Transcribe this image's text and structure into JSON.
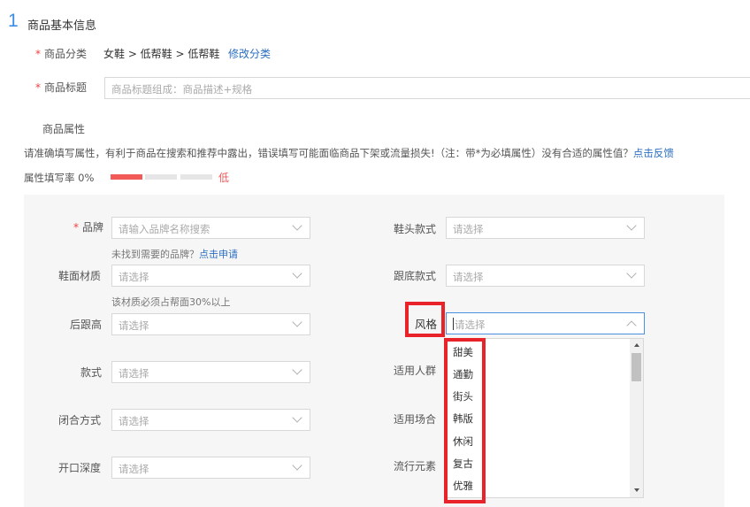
{
  "section": {
    "number": "1",
    "title": "商品基本信息"
  },
  "category": {
    "label": "商品分类",
    "path": "女鞋 > 低帮鞋 > 低帮鞋",
    "edit_link": "修改分类"
  },
  "title_field": {
    "label": "商品标题",
    "placeholder": "商品标题组成：商品描述+规格"
  },
  "attributes": {
    "heading": "商品属性",
    "notice": "请准确填写属性，有利于商品在搜索和推荐中露出，错误填写可能面临商品下架或流量损失!（注：带*为必填属性）没有合适的属性值？",
    "feedback_link": "点击反馈",
    "fill_rate_label": "属性填写率 0%",
    "fill_rate_value": 0,
    "fill_level": "低",
    "colors": {
      "bar_active": "#f25a5a",
      "bar_empty": "#e6e6e6",
      "accent": "#3a8ee6",
      "highlight": "#e8232a"
    }
  },
  "fields": {
    "brand": {
      "label": "品牌",
      "placeholder": "请输入品牌名称搜索"
    },
    "brand_hint": "未找到需要的品牌？",
    "brand_hint_link": "点击申请",
    "toe_style": {
      "label": "鞋头款式",
      "placeholder": "请选择"
    },
    "upper_material": {
      "label": "鞋面材质",
      "placeholder": "请选择"
    },
    "material_hint": "该材质必须占帮面30%以上",
    "heel_style": {
      "label": "跟底款式",
      "placeholder": "请选择"
    },
    "heel_height": {
      "label": "后跟高",
      "placeholder": "请选择"
    },
    "style": {
      "label": "风格",
      "placeholder": "请选择"
    },
    "design": {
      "label": "款式",
      "placeholder": "请选择"
    },
    "target_group": {
      "label": "适用人群"
    },
    "closure": {
      "label": "闭合方式",
      "placeholder": "请选择"
    },
    "occasion": {
      "label": "适用场合"
    },
    "opening_depth": {
      "label": "开口深度",
      "placeholder": "请选择"
    },
    "trend_element": {
      "label": "流行元素"
    }
  },
  "style_options": [
    "甜美",
    "通勤",
    "街头",
    "韩版",
    "休闲",
    "复古",
    "优雅"
  ]
}
